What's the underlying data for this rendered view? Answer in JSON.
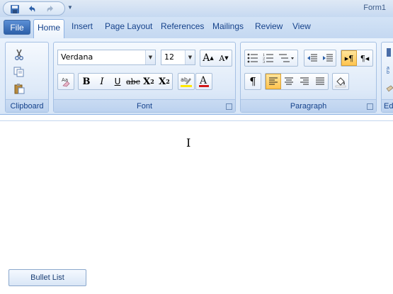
{
  "window": {
    "title": "Form1"
  },
  "tabs": [
    {
      "label": "File"
    },
    {
      "label": "Home"
    },
    {
      "label": "Insert"
    },
    {
      "label": "Page Layout"
    },
    {
      "label": "References"
    },
    {
      "label": "Mailings"
    },
    {
      "label": "Review"
    },
    {
      "label": "View"
    }
  ],
  "clipboard": {
    "label": "Clipboard",
    "icons": [
      "cut-icon",
      "copy-icon",
      "paste-icon"
    ]
  },
  "font": {
    "label": "Font",
    "family": "Verdana",
    "size": "12",
    "buttons": [
      "bold",
      "italic",
      "underline",
      "strikethrough",
      "subscript",
      "superscript"
    ],
    "bold_glyph": "B",
    "italic_glyph": "I",
    "underline_glyph": "U",
    "strike_glyph": "abc"
  },
  "paragraph": {
    "label": "Paragraph",
    "pilcrow": "¶"
  },
  "editing": {
    "label": "Ed"
  },
  "document": {
    "button_label": "Bullet List"
  },
  "colors": {
    "ribbon": "#dde9f8",
    "active_align": "#ffc44f",
    "text": "#15428b"
  }
}
